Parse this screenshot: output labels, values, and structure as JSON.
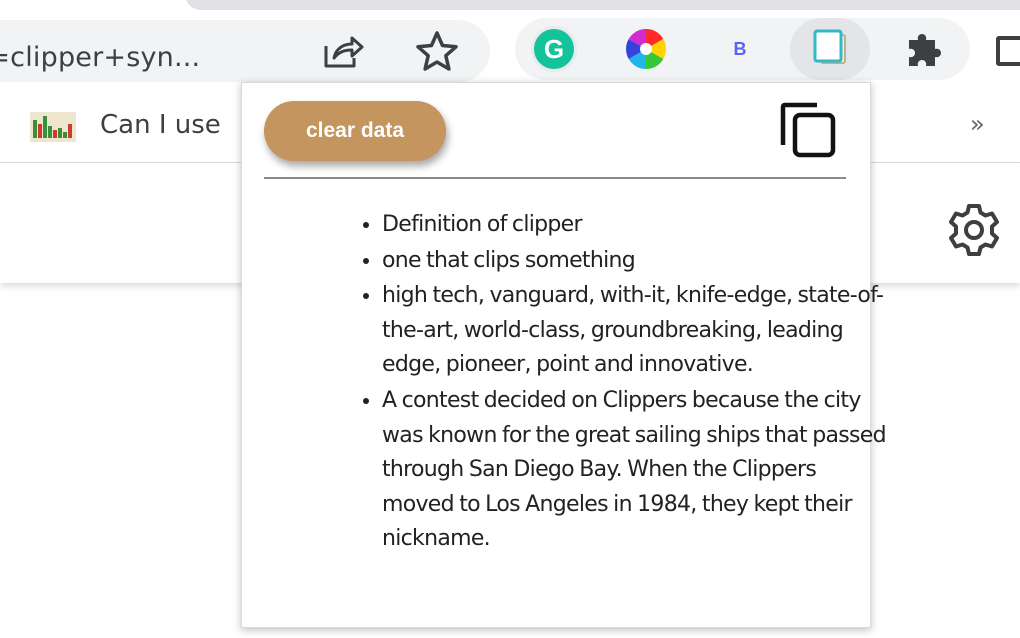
{
  "browser": {
    "omnibox_text": "q=clipper+syn...",
    "bookmark_label": "Can I use",
    "bookmark_overflow": "»",
    "extensions": {
      "grammarly_letter": "G",
      "b_letter": "B"
    }
  },
  "popup": {
    "clear_button_label": "clear data",
    "definitions": [
      "Definition of clipper",
      "one that clips something",
      "high tech, vanguard, with-it, knife-edge, state-of-the-art, world-class, groundbreaking, leading edge, pioneer, point and innovative.",
      "A contest decided on Clippers because the city was known for the great sailing ships that passed through San Diego Bay. When the Clippers moved to Los Angeles in 1984, they kept their nickname."
    ]
  },
  "colors": {
    "clear_button": "#c4955e",
    "grammarly": "#15c39a",
    "toolbar_pill": "#f1f3f4"
  },
  "icons": {
    "share": "share-icon",
    "star": "star-icon",
    "grammarly": "grammarly-icon",
    "color_picker": "color-wheel-icon",
    "clipper": "clipper-extension-icon",
    "extensions": "puzzle-icon",
    "copy": "copy-icon",
    "settings": "gear-icon"
  }
}
